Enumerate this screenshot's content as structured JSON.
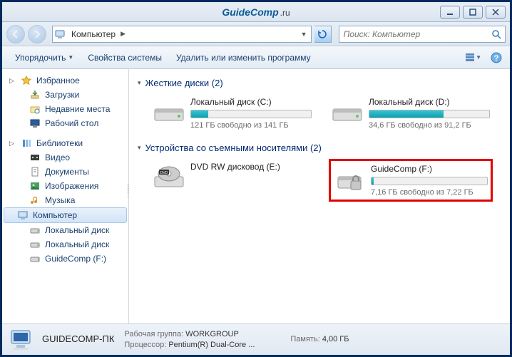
{
  "brand": {
    "name": "GuideComp",
    "suffix": ".ru"
  },
  "navbar": {
    "breadcrumb": "Компьютер"
  },
  "search": {
    "placeholder": "Поиск: Компьютер"
  },
  "toolbar": {
    "organize": "Упорядочить",
    "sysprops": "Свойства системы",
    "uninstall": "Удалить или изменить программу"
  },
  "sidebar": {
    "favorites": "Избранное",
    "downloads": "Загрузки",
    "recent": "Недавние места",
    "desktop": "Рабочий стол",
    "libraries": "Библиотеки",
    "videos": "Видео",
    "documents": "Документы",
    "pictures": "Изображения",
    "music": "Музыка",
    "computer": "Компьютер",
    "localC": "Локальный диск",
    "localD": "Локальный диск",
    "guidecomp": "GuideComp (F:)"
  },
  "groups": {
    "hdd": "Жесткие диски (2)",
    "removable": "Устройства со съемными носителями (2)"
  },
  "drives": {
    "c": {
      "label": "Локальный диск (C:)",
      "status": "121 ГБ свободно из 141 ГБ",
      "pct": 14
    },
    "d": {
      "label": "Локальный диск (D:)",
      "status": "34,6 ГБ свободно из 91,2 ГБ",
      "pct": 62
    },
    "e": {
      "label": "DVD RW дисковод (E:)"
    },
    "f": {
      "label": "GuideComp (F:)",
      "status": "7,16 ГБ свободно из 7,22 ГБ",
      "pct": 2
    }
  },
  "status": {
    "name": "GUIDECOMP-ПК",
    "wg_label": "Рабочая группа:",
    "wg_value": "WORKGROUP",
    "mem_label": "Память:",
    "mem_value": "4,00 ГБ",
    "cpu_label": "Процессор:",
    "cpu_value": "Pentium(R) Dual-Core ..."
  },
  "colors": {
    "highlight": "#e40000",
    "barfill": "#0ea0b1"
  }
}
